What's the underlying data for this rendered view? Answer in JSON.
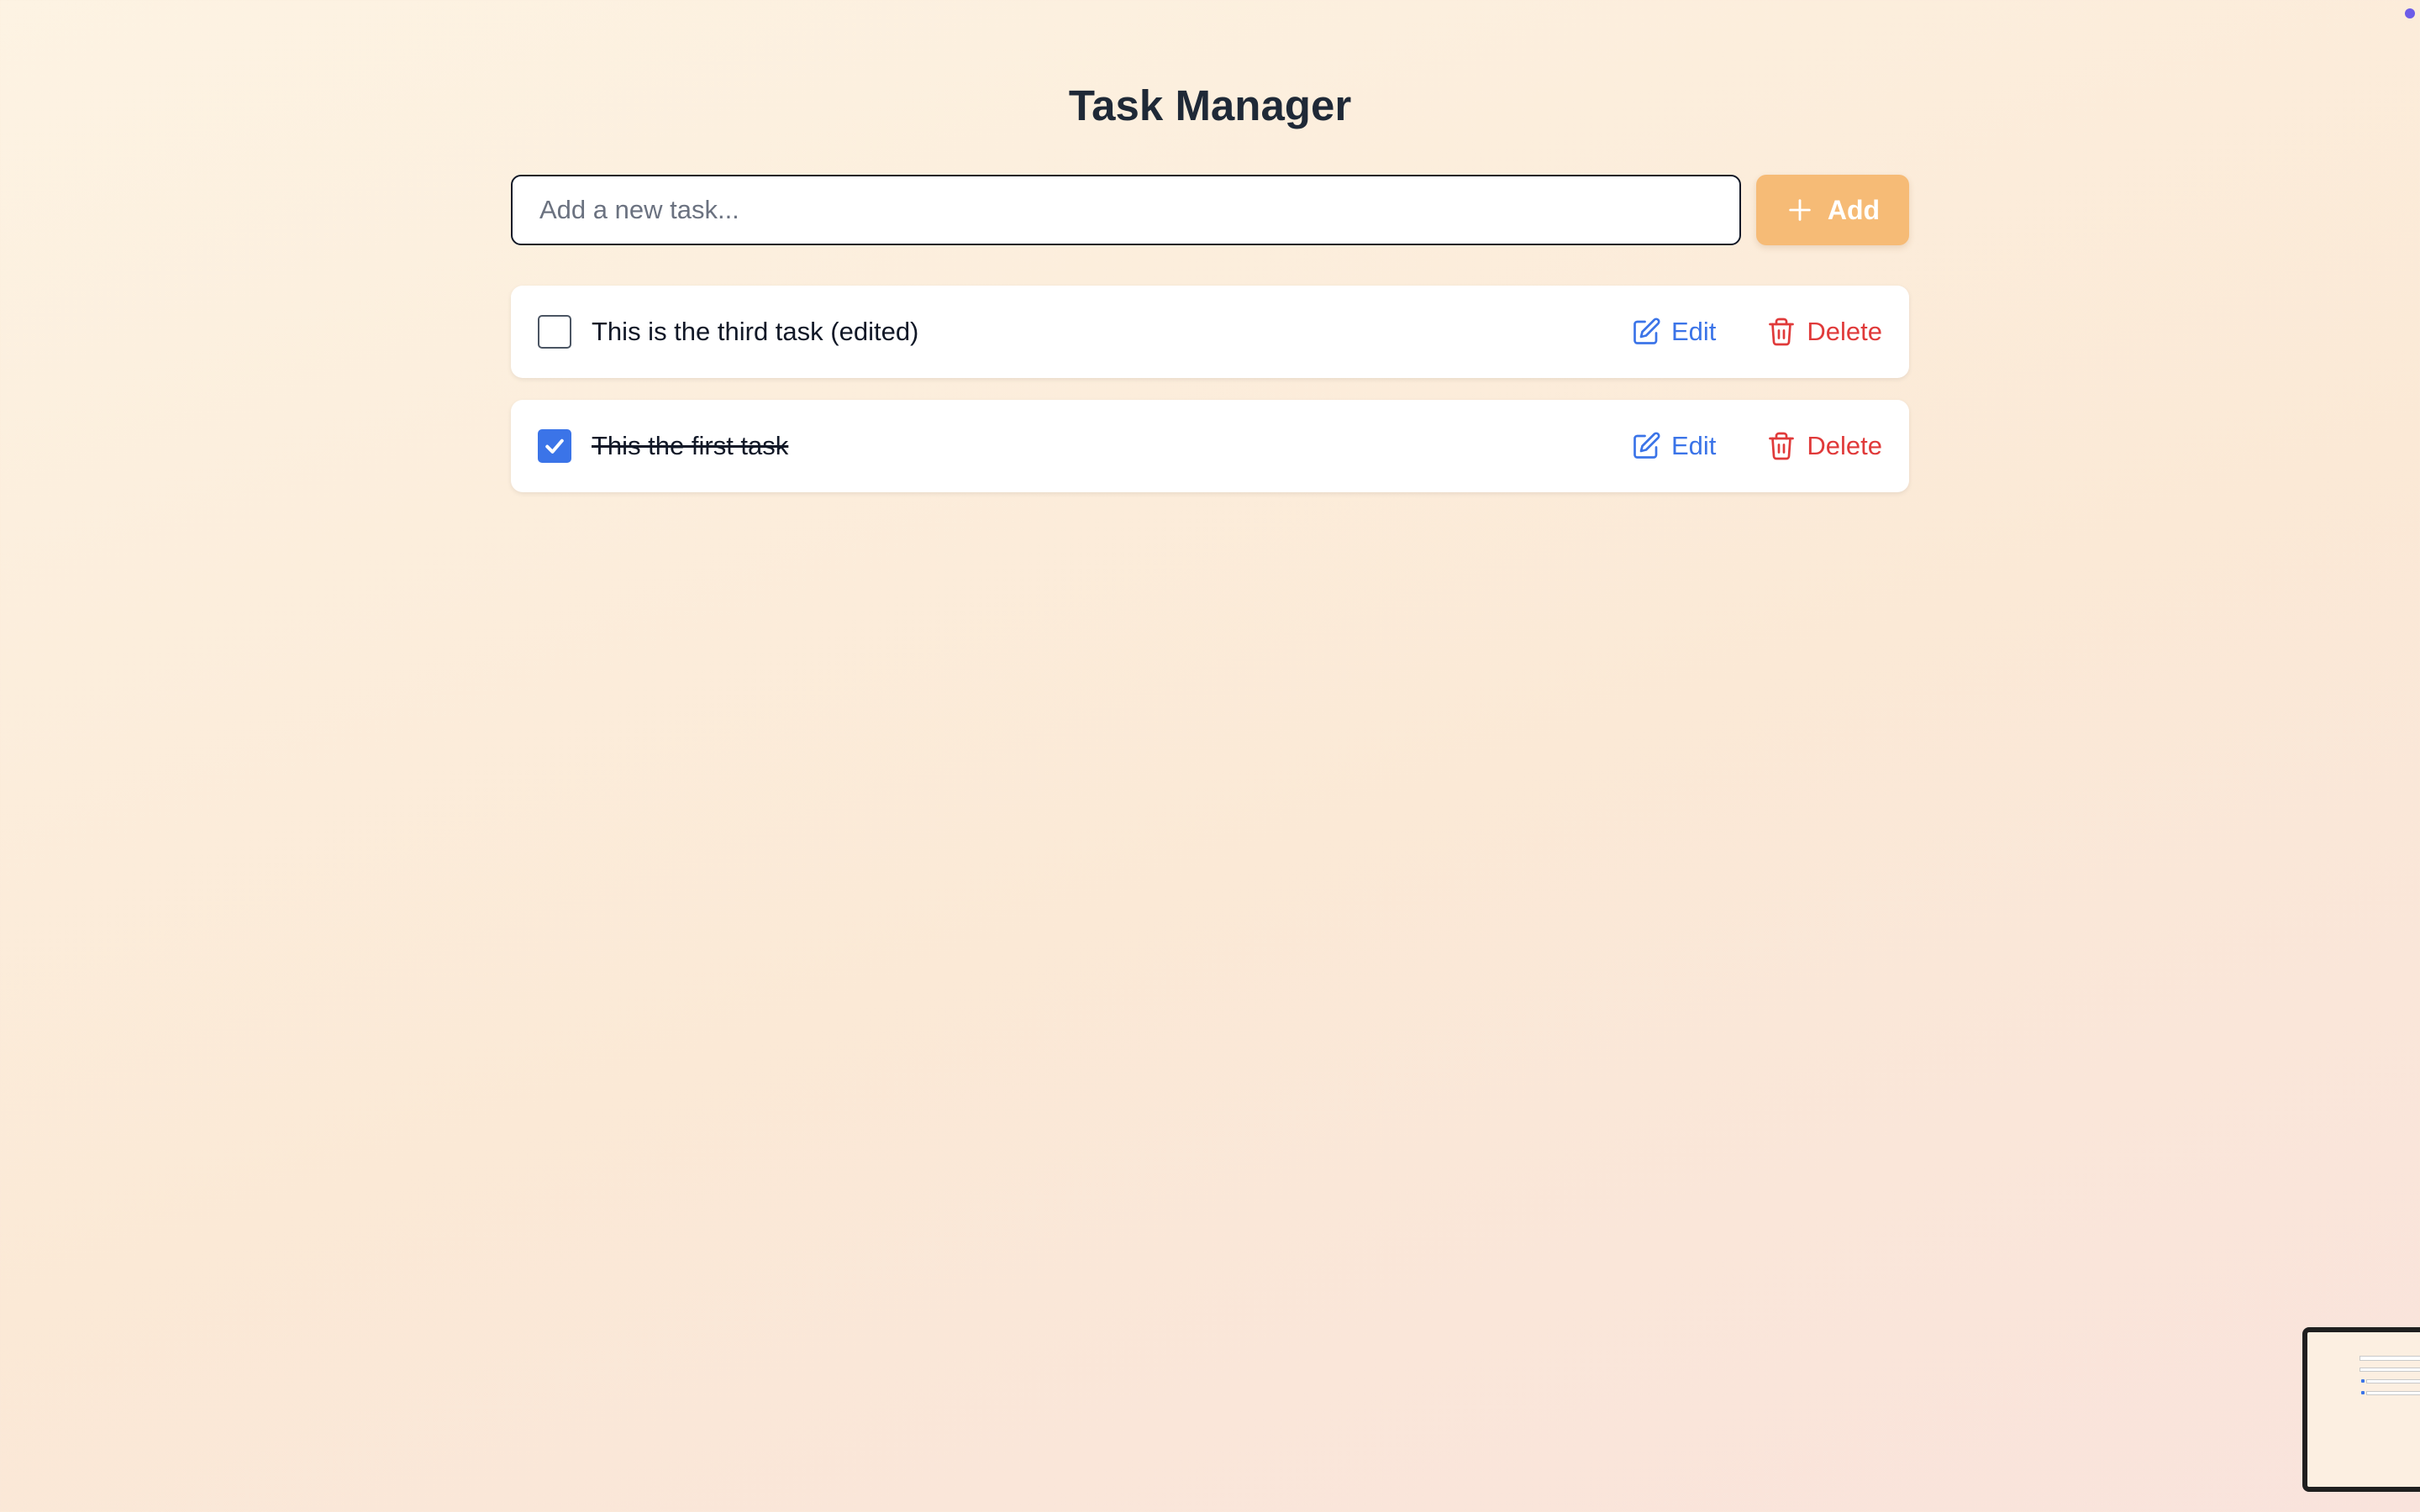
{
  "app": {
    "title": "Task Manager"
  },
  "add_form": {
    "input_value": "",
    "placeholder": "Add a new task...",
    "add_label": "Add",
    "add_icon": "plus-icon",
    "add_color": "#f6bb76"
  },
  "tasks": [
    {
      "text": "This is the third task (edited)",
      "completed": false,
      "edit_label": "Edit",
      "delete_label": "Delete"
    },
    {
      "text": "This the first task",
      "completed": true,
      "edit_label": "Edit",
      "delete_label": "Delete"
    }
  ],
  "icons": {
    "edit": "pencil-square-icon",
    "delete": "trash-icon",
    "check": "check-icon"
  },
  "colors": {
    "accent": "#3b74e8",
    "danger": "#e03a3a",
    "status_dot": "#6d5ce8"
  }
}
